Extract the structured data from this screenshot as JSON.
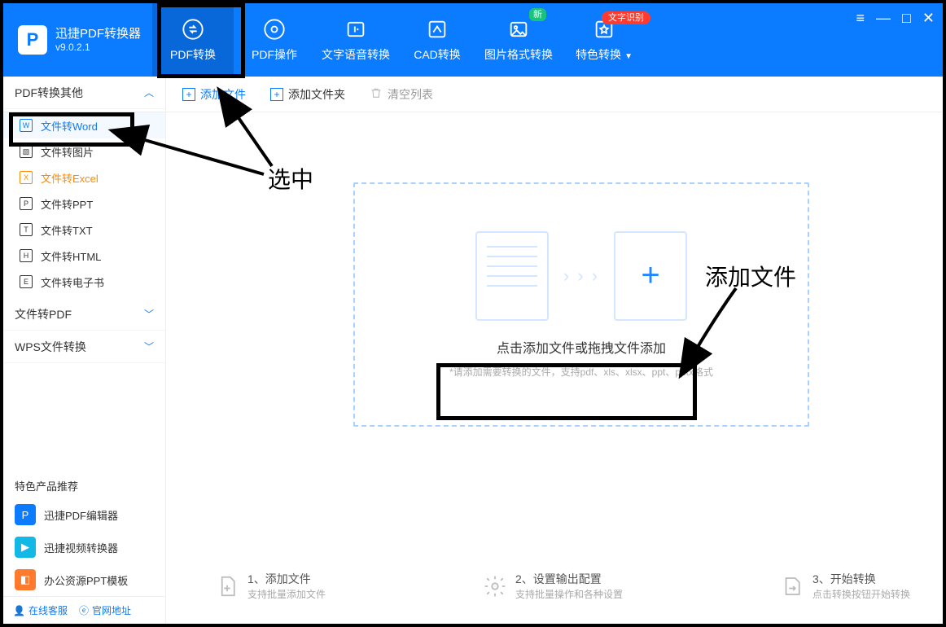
{
  "app": {
    "name": "迅捷PDF转换器",
    "version": "v9.0.2.1"
  },
  "header_tabs": [
    {
      "label": "PDF转换",
      "active": true
    },
    {
      "label": "PDF操作"
    },
    {
      "label": "文字语音转换"
    },
    {
      "label": "CAD转换"
    },
    {
      "label": "图片格式转换",
      "badge": "新"
    },
    {
      "label": "特色转换",
      "dropdown": true,
      "badge_red": "文字识别"
    }
  ],
  "toolbar": {
    "add_file": "添加文件",
    "add_folder": "添加文件夹",
    "clear": "清空列表"
  },
  "sidebar": {
    "group1": {
      "title": "PDF转换其他",
      "expanded": true
    },
    "items": [
      {
        "label": "文件转Word",
        "active": true
      },
      {
        "label": "文件转图片"
      },
      {
        "label": "文件转Excel",
        "orange": true
      },
      {
        "label": "文件转PPT"
      },
      {
        "label": "文件转TXT"
      },
      {
        "label": "文件转HTML"
      },
      {
        "label": "文件转电子书"
      }
    ],
    "group2": {
      "title": "文件转PDF"
    },
    "group3": {
      "title": "WPS文件转换"
    },
    "recommend_title": "特色产品推荐",
    "recs": [
      {
        "label": "迅捷PDF编辑器"
      },
      {
        "label": "迅捷视频转换器"
      },
      {
        "label": "办公资源PPT模板"
      }
    ],
    "bottom": {
      "cs": "在线客服",
      "site": "官网地址"
    }
  },
  "dropzone": {
    "title": "点击添加文件或拖拽文件添加",
    "sub": "*请添加需要转换的文件，支持pdf、xls、xlsx、ppt、pptx格式"
  },
  "steps": [
    {
      "t": "1、添加文件",
      "s": "支持批量添加文件"
    },
    {
      "t": "2、设置输出配置",
      "s": "支持批量操作和各种设置"
    },
    {
      "t": "3、开始转换",
      "s": "点击转换按钮开始转换"
    }
  ],
  "annotations": {
    "select_label": "选中",
    "add_label": "添加文件"
  }
}
